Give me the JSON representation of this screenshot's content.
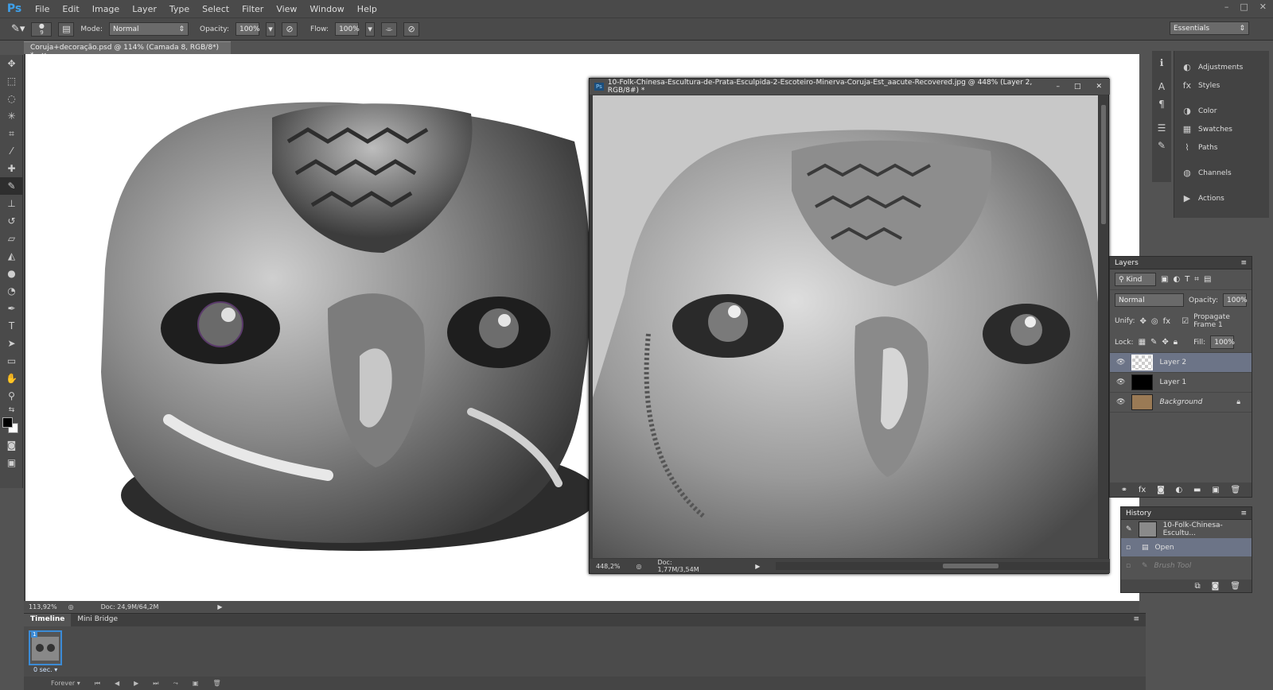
{
  "app": {
    "logo": "Ps"
  },
  "menu": [
    "File",
    "Edit",
    "Image",
    "Layer",
    "Type",
    "Select",
    "Filter",
    "View",
    "Window",
    "Help"
  ],
  "window_controls": [
    "–",
    "□",
    "✕"
  ],
  "options_bar": {
    "brush_size": "9",
    "mode_label": "Mode:",
    "mode_value": "Normal",
    "opacity_label": "Opacity:",
    "opacity_value": "100%",
    "flow_label": "Flow:",
    "flow_value": "100%"
  },
  "workspace": "Essentials",
  "document_tab": {
    "title": "Coruja+decoração.psd @ 114% (Camada 8, RGB/8*) *",
    "close": "×"
  },
  "main_status": {
    "zoom": "113,92%",
    "doc": "Doc: 24,9M/64,2M"
  },
  "float_window": {
    "badge": "Ps",
    "title": "10-Folk-Chinesa-Escultura-de-Prata-Esculpida-2-Escoteiro-Minerva-Coruja-Est_aacute-Recovered.jpg @ 448% (Layer 2, RGB/8#) *",
    "zoom": "448,2%",
    "doc": "Doc: 1,77M/3,54M"
  },
  "dock_panels": [
    {
      "icon": "adjustments-icon",
      "glyph": "◐",
      "label": "Adjustments"
    },
    {
      "icon": "styles-icon",
      "glyph": "fx",
      "label": "Styles"
    },
    {
      "icon": "color-icon",
      "glyph": "◑",
      "label": "Color"
    },
    {
      "icon": "swatches-icon",
      "glyph": "▦",
      "label": "Swatches"
    },
    {
      "icon": "paths-icon",
      "glyph": "⌇",
      "label": "Paths"
    },
    {
      "icon": "channels-icon",
      "glyph": "◍",
      "label": "Channels"
    },
    {
      "icon": "actions-icon",
      "glyph": "▶",
      "label": "Actions"
    }
  ],
  "layers_panel": {
    "title": "Layers",
    "filter_kind": "Kind",
    "blend_mode": "Normal",
    "opacity_label": "Opacity:",
    "opacity_value": "100%",
    "unify_label": "Unify:",
    "propagate_label": "Propagate Frame 1",
    "lock_label": "Lock:",
    "fill_label": "Fill:",
    "fill_value": "100%",
    "layers": [
      {
        "name": "Layer 2",
        "selected": true,
        "thumb": "transparent"
      },
      {
        "name": "Layer 1",
        "selected": false,
        "thumb": "#000000"
      },
      {
        "name": "Background",
        "selected": false,
        "thumb": "#9a7a55",
        "locked": true
      }
    ]
  },
  "history_panel": {
    "title": "History",
    "snapshot": "10-Folk-Chinesa-Escultu...",
    "items": [
      {
        "label": "Open",
        "selected": true
      },
      {
        "label": "Brush Tool",
        "selected": false
      }
    ]
  },
  "timeline": {
    "tabs": [
      "Timeline",
      "Mini Bridge"
    ],
    "frame_number": "1",
    "frame_duration": "0 sec.",
    "loop": "Forever"
  },
  "colors": {
    "accent": "#3b8bd6",
    "panel_bg": "#535353",
    "selection": "#6c7487"
  }
}
